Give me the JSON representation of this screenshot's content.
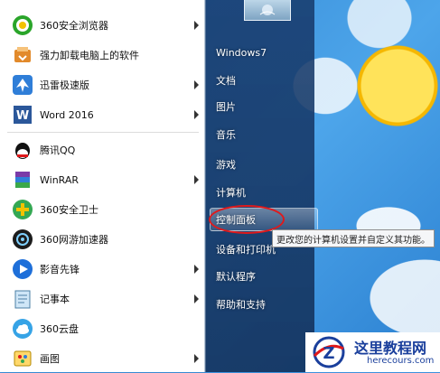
{
  "programs": [
    {
      "label": "360安全浏览器",
      "icon": "browser-360-icon",
      "arrow": true
    },
    {
      "label": "强力卸载电脑上的软件",
      "icon": "uninstall-icon",
      "arrow": false
    },
    {
      "label": "迅雷极速版",
      "icon": "thunder-icon",
      "arrow": true
    },
    {
      "label": "Word 2016",
      "icon": "word-icon",
      "arrow": true
    },
    {
      "label": "腾讯QQ",
      "icon": "qq-icon",
      "arrow": false
    },
    {
      "label": "WinRAR",
      "icon": "winrar-icon",
      "arrow": true
    },
    {
      "label": "360安全卫士",
      "icon": "security-360-icon",
      "arrow": false
    },
    {
      "label": "360网游加速器",
      "icon": "game-accelerator-icon",
      "arrow": false
    },
    {
      "label": "影音先锋",
      "icon": "media-player-icon",
      "arrow": true
    },
    {
      "label": "记事本",
      "icon": "notepad-icon",
      "arrow": true
    },
    {
      "label": "360云盘",
      "icon": "cloud-drive-icon",
      "arrow": false
    },
    {
      "label": "画图",
      "icon": "paint-icon",
      "arrow": true
    }
  ],
  "right_items": [
    {
      "label": "Windows7"
    },
    {
      "label": "文档"
    },
    {
      "label": "图片"
    },
    {
      "label": "音乐"
    },
    {
      "label": "游戏"
    },
    {
      "label": "计算机"
    },
    {
      "label": "控制面板"
    },
    {
      "label": "设备和打印机"
    },
    {
      "label": "默认程序"
    },
    {
      "label": "帮助和支持"
    }
  ],
  "tooltip": "更改您的计算机设置并自定义其功能。",
  "watermark": {
    "title": "这里教程网",
    "url": "herecours.com",
    "logo_letter": "Z"
  },
  "colors": {
    "highlight_circle": "#e0191b",
    "right_pane": "#1e3f70"
  }
}
